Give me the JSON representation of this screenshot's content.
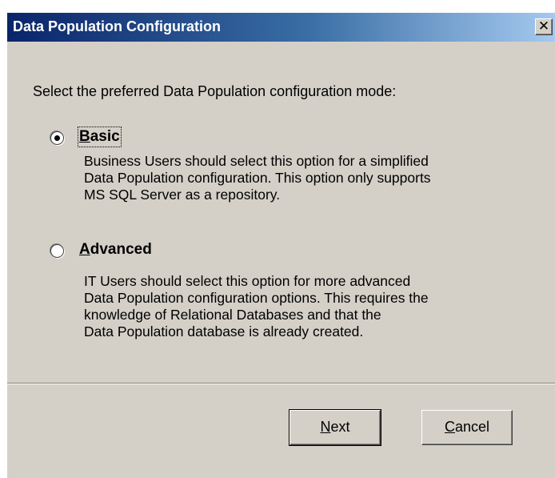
{
  "window": {
    "title": "Data Population Configuration",
    "close_glyph": "✕"
  },
  "prompt": "Select the preferred Data Population configuration mode:",
  "options": [
    {
      "label_accel": "B",
      "label_rest": "asic",
      "selected": true,
      "description": [
        "Business Users should select this option for a simplified",
        "Data Population configuration. This option only supports",
        "MS SQL Server as a repository."
      ]
    },
    {
      "label_accel": "A",
      "label_rest": "dvanced",
      "selected": false,
      "description": [
        "IT Users should select this option for more advanced",
        "Data Population configuration options. This requires the",
        "knowledge of Relational Databases and that the",
        "Data Population database is already created."
      ]
    }
  ],
  "buttons": {
    "next_accel": "N",
    "next_rest": "ext",
    "cancel_accel": "C",
    "cancel_rest": "ancel"
  }
}
